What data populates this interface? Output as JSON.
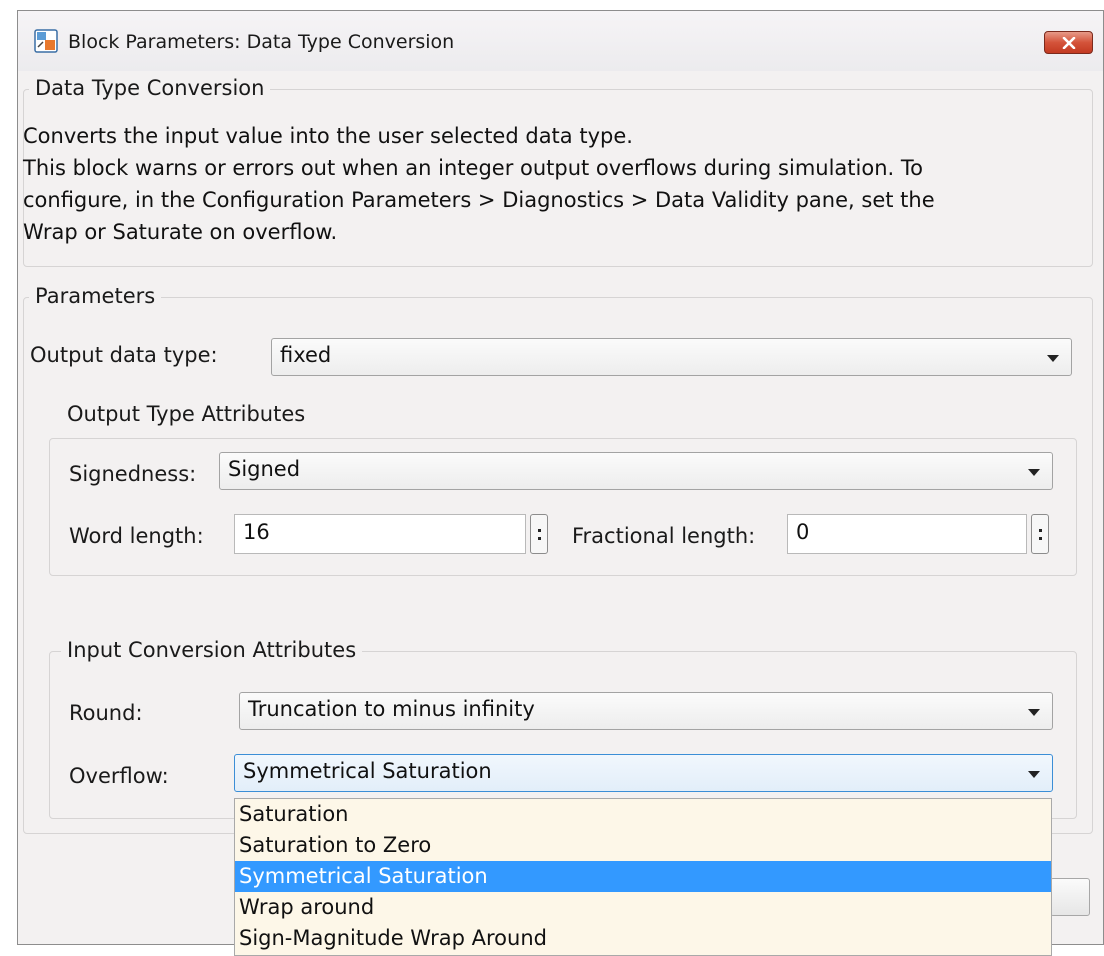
{
  "window": {
    "title": "Block Parameters: Data Type Conversion",
    "app_icon": "simulink-block-icon",
    "close_icon": "close-icon"
  },
  "description": {
    "group_title": "Data Type Conversion",
    "lines": [
      "Converts the input value into the user selected data type.",
      "This block warns or errors out when an integer output overflows during simulation. To",
      "configure, in the Configuration Parameters > Diagnostics > Data Validity pane, set the",
      "Wrap or Saturate on overflow."
    ]
  },
  "parameters": {
    "group_title": "Parameters",
    "output_data_type_label": "Output data type:",
    "output_data_type_value": "fixed",
    "output_type_attributes": {
      "group_title": "Output Type Attributes",
      "signedness_label": "Signedness:",
      "signedness_value": "Signed",
      "word_length_label": "Word length:",
      "word_length_value": "16",
      "fractional_length_label": "Fractional length:",
      "fractional_length_value": "0"
    },
    "input_conversion_attributes": {
      "group_title": "Input Conversion Attributes",
      "round_label": "Round:",
      "round_value": "Truncation to minus infinity",
      "overflow_label": "Overflow:",
      "overflow_value": "Symmetrical Saturation",
      "overflow_options": [
        "Saturation",
        "Saturation to Zero",
        "Symmetrical Saturation",
        "Wrap around",
        "Sign-Magnitude Wrap Around"
      ],
      "overflow_selected_index": 2
    }
  },
  "colors": {
    "selection_highlight": "#3399ff",
    "dropdown_background": "#fdf7e8",
    "close_button": "#c9432b"
  }
}
